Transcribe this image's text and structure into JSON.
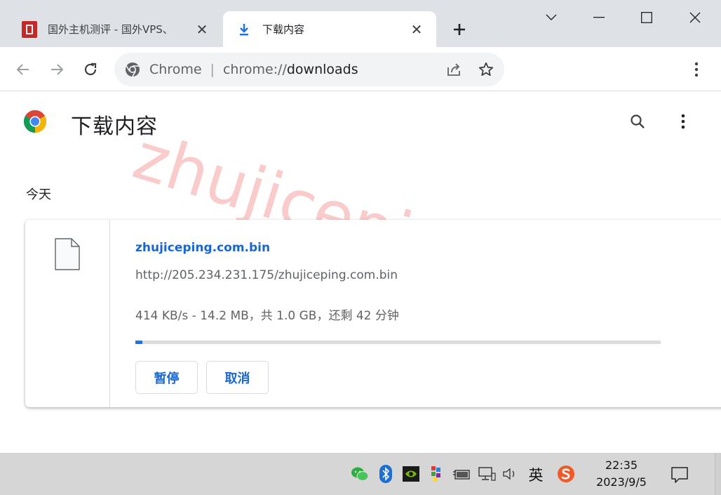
{
  "tabs": [
    {
      "title": "国外主机测评 - 国外VPS、",
      "favicon": "site-logo-icon",
      "active": false
    },
    {
      "title": "下载内容",
      "favicon": "download-icon",
      "active": true
    }
  ],
  "omnibox": {
    "site_label": "Chrome",
    "url_scheme": "chrome://",
    "url_host": "downloads"
  },
  "page": {
    "title": "下载内容",
    "date_group": "今天"
  },
  "download": {
    "file_name": "zhujiceping.com.bin",
    "url": "http://205.234.231.175/zhujiceping.com.bin",
    "status": "414 KB/s - 14.2 MB，共 1.0 GB，还剩 42 分钟",
    "progress_percent": 1.4,
    "pause_label": "暂停",
    "cancel_label": "取消"
  },
  "watermark": "zhujiceping.com",
  "taskbar": {
    "ime_label": "英",
    "time": "22:35",
    "date": "2023/9/5"
  },
  "colors": {
    "accent": "#1a73e8",
    "link": "#1967d2",
    "tabstrip": "#dee1e6",
    "watermark": "#f7b9b9"
  }
}
